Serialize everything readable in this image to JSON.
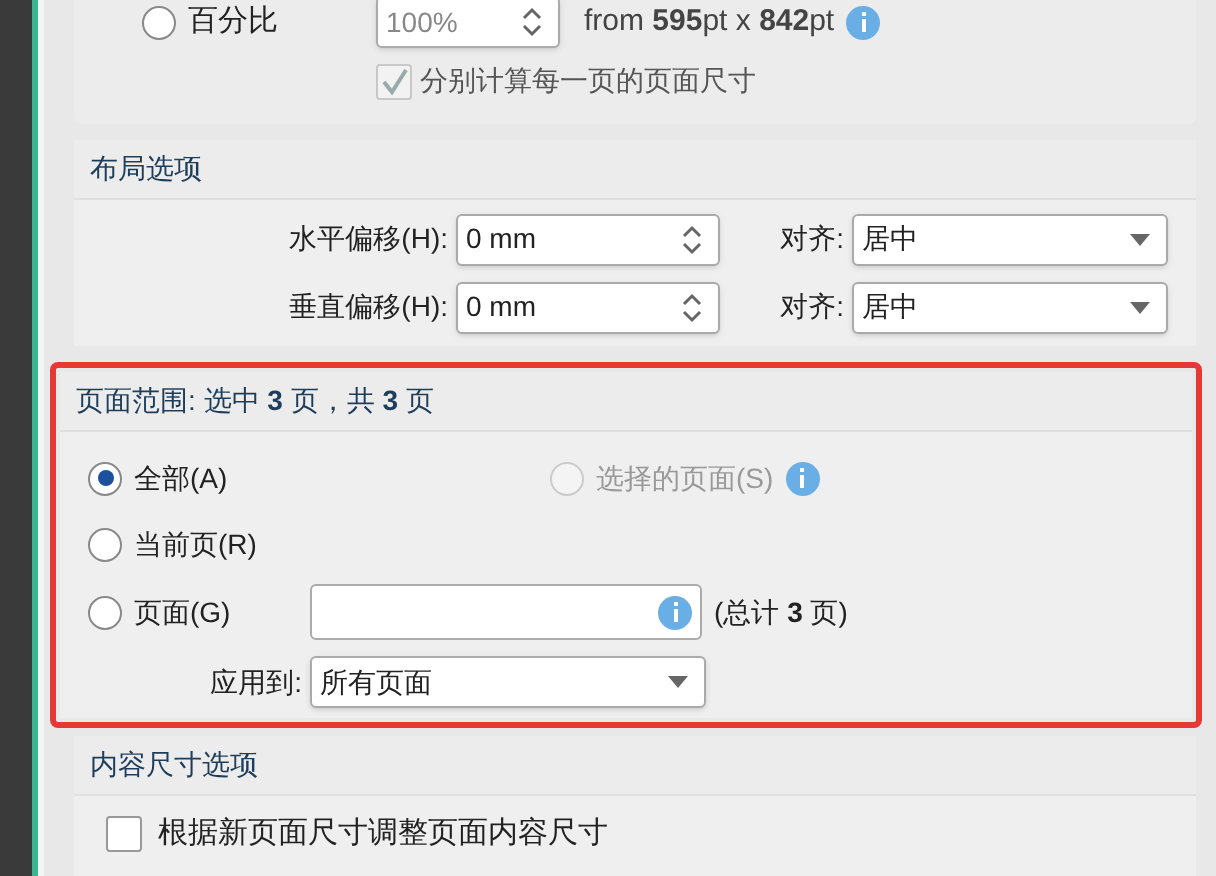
{
  "scale_section": {
    "option": {
      "label": "百分比",
      "selected": false
    },
    "percent": {
      "value": "100%"
    },
    "from_text": "from **595**pt x **842**pt",
    "per_page": {
      "label": "分别计算每一页的页面尺寸",
      "checked": true,
      "disabled": true
    }
  },
  "layout_section": {
    "title": "布局选项",
    "rows": [
      {
        "label": "水平偏移(H):",
        "value": "0 mm",
        "align_label": "对齐:",
        "align_value": "居中"
      },
      {
        "label": "垂直偏移(H):",
        "value": "0 mm",
        "align_label": "对齐:",
        "align_value": "居中"
      }
    ]
  },
  "page_range_section": {
    "title": "页面范围: 选中 **3** 页，共 **3** 页",
    "highlighted": true,
    "all": {
      "label": "全部(A)",
      "selected": true
    },
    "selected_pages": {
      "label": "选择的页面(S)",
      "selected": false,
      "disabled": true
    },
    "current": {
      "label": "当前页(R)",
      "selected": false
    },
    "pages": {
      "label": "页面(G)",
      "selected": false
    },
    "total": "(总计 **3** 页)",
    "apply_label": "应用到:",
    "apply_value": "所有页面"
  },
  "content_section": {
    "title": "内容尺寸选项",
    "resize": {
      "label": "根据新页面尺寸调整页面内容尺寸",
      "checked": false
    }
  }
}
